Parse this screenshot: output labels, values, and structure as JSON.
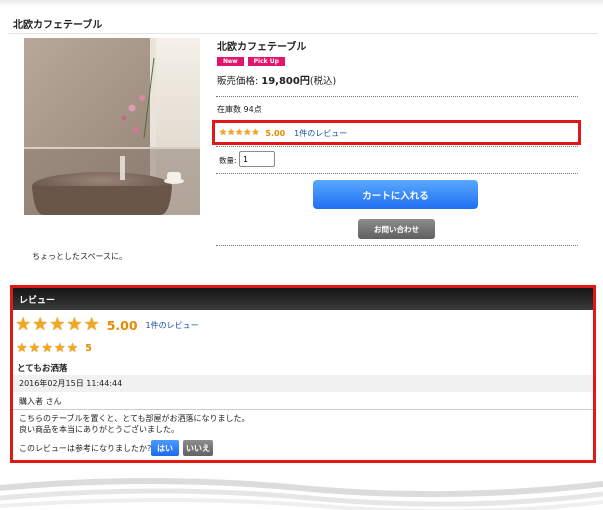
{
  "product": {
    "heading": "北欧カフェテーブル",
    "name": "北欧カフェテーブル",
    "badges": [
      "New",
      "Pick Up"
    ],
    "price_label": "販売価格:",
    "price_value": "19,800円",
    "price_tax": "(税込)",
    "stock": "在庫数 94点",
    "rating": {
      "stars": 5,
      "score": "5.00",
      "review_link": "1件のレビュー"
    },
    "quantity_label": "数量:",
    "quantity_value": "1",
    "cart_button": "カートに入れる",
    "inquiry_button": "お問い合わせ",
    "caption": "ちょっとしたスペースに。"
  },
  "review": {
    "header": "レビュー",
    "summary": {
      "stars": 5,
      "score": "5.00",
      "count_link": "1件のレビュー"
    },
    "item": {
      "stars": 5,
      "score": "5",
      "title": "とてもお洒落",
      "date": "2016年02月15日 11:44:44",
      "author": "購入者 さん",
      "body_line1": "こちらのテーブルを置くと、とても部屋がお洒落になりました。",
      "body_line2": "良い商品を本当にありがとうございました。"
    },
    "helpful_question": "このレビューは参考になりましたか？",
    "yes_button": "はい",
    "no_button": "いいえ"
  },
  "colors": {
    "badge": "#e2146b",
    "star": "#f3a61e",
    "score": "#e58a00",
    "link": "#1a4fa8",
    "highlight": "#e01818",
    "cart_button": "#2f86f7"
  }
}
